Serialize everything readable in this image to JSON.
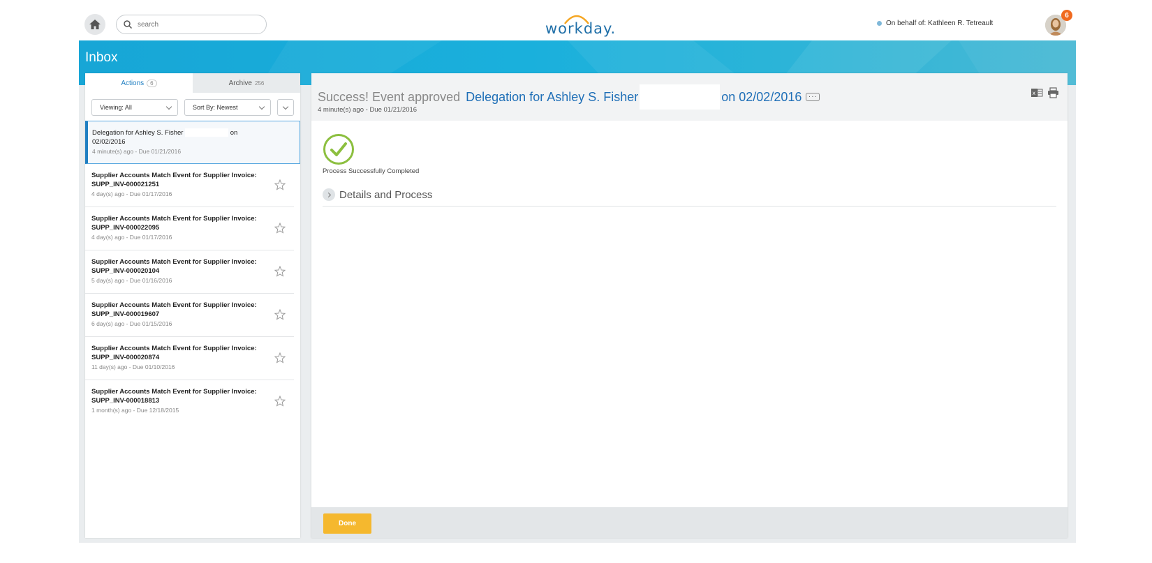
{
  "header": {
    "search_placeholder": "search",
    "logo_text": "workday.",
    "on_behalf": "On behalf of: Kathleen R. Tetreault",
    "notification_count": "6"
  },
  "inbox": {
    "title": "Inbox",
    "tabs": [
      {
        "label": "Actions",
        "count": "6"
      },
      {
        "label": "Archive",
        "count": "256"
      }
    ],
    "viewing": "Viewing: All",
    "sort": "Sort By: Newest",
    "items": [
      {
        "title_a": "Delegation for Ashley S. Fisher",
        "title_b": "on",
        "title_c": "02/02/2016",
        "meta": "4 minute(s) ago - Due 01/21/2016"
      },
      {
        "title": "Supplier Accounts Match Event for Supplier Invoice: SUPP_INV-000021251",
        "meta": "4 day(s) ago - Due 01/17/2016"
      },
      {
        "title": "Supplier Accounts Match Event for Supplier Invoice: SUPP_INV-000022095",
        "meta": "4 day(s) ago - Due 01/17/2016"
      },
      {
        "title": "Supplier Accounts Match Event for Supplier Invoice: SUPP_INV-000020104",
        "meta": "5 day(s) ago - Due 01/16/2016"
      },
      {
        "title": "Supplier Accounts Match Event for Supplier Invoice: SUPP_INV-000019607",
        "meta": "6 day(s) ago - Due 01/15/2016"
      },
      {
        "title": "Supplier Accounts Match Event for Supplier Invoice: SUPP_INV-000020874",
        "meta": "11 day(s) ago - Due 01/10/2016"
      },
      {
        "title": "Supplier Accounts Match Event for Supplier Invoice: SUPP_INV-000018813",
        "meta": "1 month(s) ago - Due 12/18/2015"
      }
    ]
  },
  "detail": {
    "title_prefix": "Success! Event approved",
    "title_link": "Delegation for Ashley S. Fisher",
    "title_suffix": "on 02/02/2016",
    "subtitle": "4 minute(s) ago - Due 01/21/2016",
    "status_text": "Process Successfully Completed",
    "details_label": "Details and Process",
    "done_label": "Done"
  },
  "colors": {
    "accent": "#1f7ec1",
    "banner": "#1aaedb",
    "success": "#8cbf3f",
    "done_button": "#f5b82e"
  }
}
